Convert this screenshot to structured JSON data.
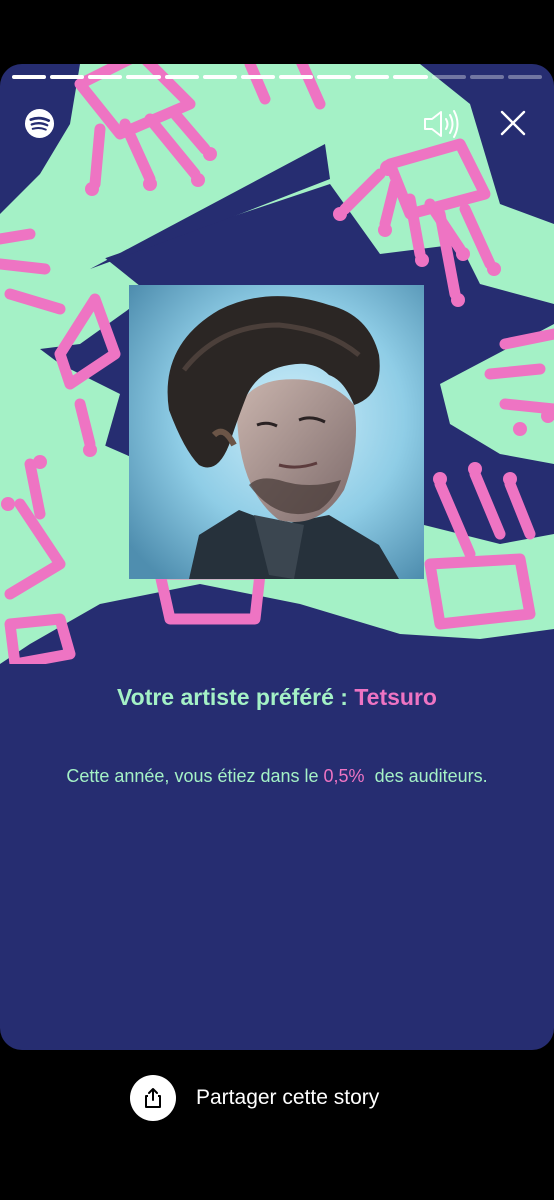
{
  "progress": {
    "total_segments": 14,
    "completed_segments": 11
  },
  "header": {
    "logo_icon": "spotify-logo-icon",
    "sound_icon": "speaker-volume-icon",
    "close_icon": "close-icon"
  },
  "story": {
    "artist_image_alt": "Tetsuro",
    "headline_prefix": "Votre artiste préféré : ",
    "artist_name": "Tetsuro",
    "subtext_prefix": "Cette année, vous étiez dans le ",
    "percentage": "0,5%",
    "subtext_suffix": "  des auditeurs."
  },
  "share": {
    "icon": "share-icon",
    "label": "Partager cette story"
  },
  "colors": {
    "background_navy": "#262d71",
    "mint": "#a4f1c6",
    "pink": "#ee74c3",
    "app_bg": "#000000"
  }
}
